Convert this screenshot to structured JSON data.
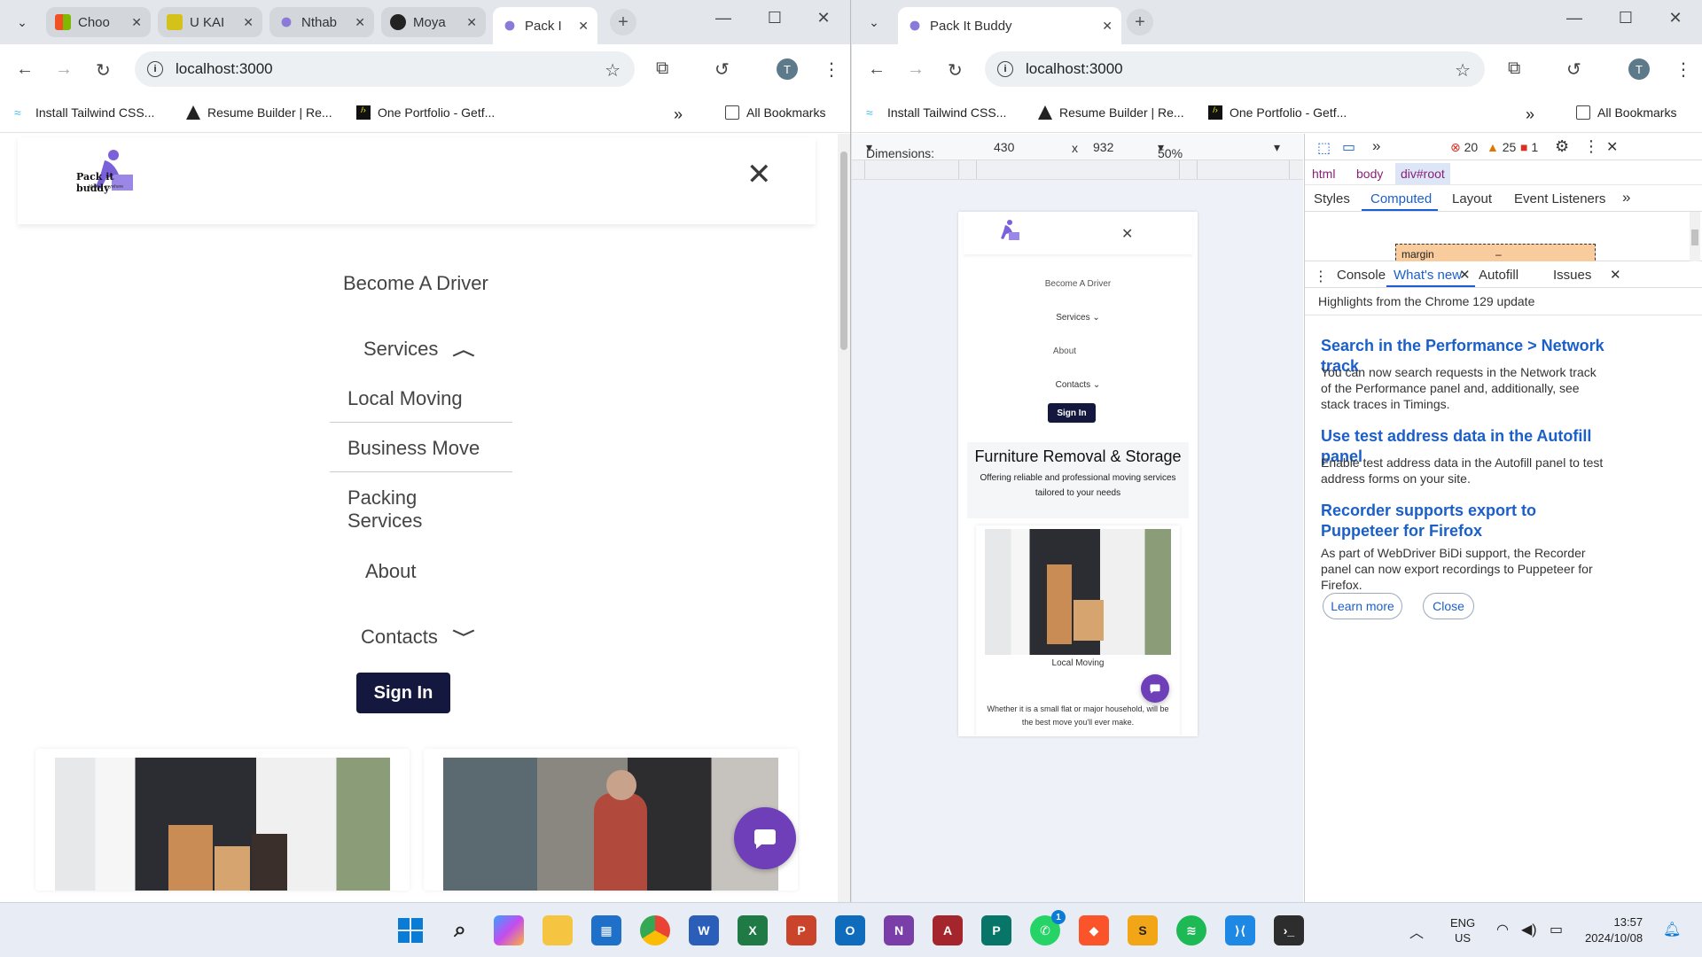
{
  "left_window": {
    "tabs": [
      {
        "title": "Choo",
        "fav": "#f25022"
      },
      {
        "title": "U KAI",
        "fav": "#d4c21a"
      },
      {
        "title": "Nthab",
        "fav": "#8b7ad8"
      },
      {
        "title": "Moya",
        "fav": "#222222"
      },
      {
        "title": "Pack I",
        "fav": "#8b7ad8"
      }
    ],
    "url": "localhost:3000",
    "profile_initial": "T",
    "bookmarks": [
      "Install Tailwind CSS...",
      "Resume Builder | Re...",
      "One Portfolio - Getf..."
    ],
    "all_bookmarks": "All Bookmarks",
    "page": {
      "logo_text": "Pack it buddy",
      "logo_sub": "Move it anywhere",
      "menu": {
        "become_driver": "Become A Driver",
        "services": "Services",
        "services_sub": [
          "Local Moving",
          "Business Move",
          "Packing Services"
        ],
        "about": "About",
        "contacts": "Contacts",
        "sign_in": "Sign In"
      }
    }
  },
  "right_window": {
    "tab_title": "Pack It Buddy",
    "url": "localhost:3000",
    "profile_initial": "T",
    "bookmarks": [
      "Install Tailwind CSS...",
      "Resume Builder | Re...",
      "One Portfolio - Getf..."
    ],
    "all_bookmarks": "All Bookmarks",
    "device_toolbar": {
      "dimensions_label": "Dimensions: iPho...",
      "width": "430",
      "times": "x",
      "height": "932",
      "zoom": "50%"
    },
    "mobile_page": {
      "menu": [
        "Become A Driver",
        "Services",
        "About",
        "Contacts"
      ],
      "sign_in": "Sign In",
      "hero_title": "Furniture Removal & Storage",
      "hero_sub": "Offering reliable and professional moving services tailored to your needs",
      "card_caption": "Local Moving",
      "card_text": "Whether it is a small flat or major household, will be the best move you'll ever make."
    },
    "devtools": {
      "breadcrumbs": [
        "html",
        "body",
        "div#root"
      ],
      "panel_tabs": [
        "Styles",
        "Computed",
        "Layout",
        "Event Listeners"
      ],
      "selected_panel_tab": "Computed",
      "box_model_label": "margin",
      "box_model_value": "–",
      "errors": "20",
      "warnings": "25",
      "issues": "1",
      "drawer_tabs": [
        "Console",
        "What's new",
        "Autofill",
        "Issues"
      ],
      "whats_new_header": "Highlights from the Chrome 129 update",
      "items": [
        {
          "title": "Search in the Performance > Network track",
          "body": "You can now search requests in the Network track of the Performance panel and, additionally, see stack traces in Timings."
        },
        {
          "title": "Use test address data in the Autofill panel",
          "body": "Enable test address data in the Autofill panel to test address forms on your site."
        },
        {
          "title": "Recorder supports export to Puppeteer for Firefox",
          "body": "As part of WebDriver BiDi support, the Recorder panel can now export recordings to Puppeteer for Firefox."
        }
      ],
      "learn_more": "Learn more",
      "close": "Close"
    }
  },
  "taskbar": {
    "language": "ENG",
    "region": "US",
    "time": "13:57",
    "date": "2024/10/08",
    "whatsapp_badge": "1"
  }
}
